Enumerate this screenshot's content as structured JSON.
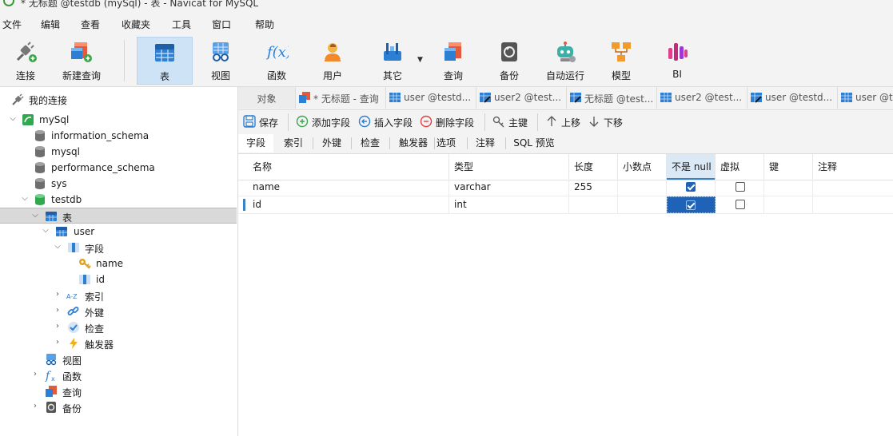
{
  "window": {
    "title": "* 无标题 @testdb (mySql) - 表 - Navicat for MySQL"
  },
  "menu": [
    "文件",
    "编辑",
    "查看",
    "收藏夹",
    "工具",
    "窗口",
    "帮助"
  ],
  "toolbar": {
    "items": [
      {
        "label": "连接",
        "icon": "connection-plug-icon"
      },
      {
        "label": "新建查询",
        "icon": "new-query-icon"
      },
      {
        "label": "表",
        "icon": "table-icon",
        "active": true
      },
      {
        "label": "视图",
        "icon": "view-icon"
      },
      {
        "label": "函数",
        "icon": "function-icon",
        "glyph": "f(x)"
      },
      {
        "label": "用户",
        "icon": "user-icon"
      },
      {
        "label": "其它",
        "icon": "tools-icon"
      },
      {
        "label": "查询",
        "icon": "query-icon"
      },
      {
        "label": "备份",
        "icon": "backup-icon"
      },
      {
        "label": "自动运行",
        "icon": "robot-icon"
      },
      {
        "label": "模型",
        "icon": "model-icon"
      },
      {
        "label": "BI",
        "icon": "bi-icon"
      }
    ]
  },
  "sidebar": {
    "header": "我的连接",
    "tree": [
      {
        "label": "mySql",
        "icon": "mysql-connection-icon",
        "chevron": "down"
      },
      {
        "label": "information_schema",
        "icon": "database-icon"
      },
      {
        "label": "mysql",
        "icon": "database-icon"
      },
      {
        "label": "performance_schema",
        "icon": "database-icon"
      },
      {
        "label": "sys",
        "icon": "database-icon"
      },
      {
        "label": "testdb",
        "icon": "database-open-icon",
        "chevron": "down"
      },
      {
        "label": "表",
        "icon": "tables-folder-icon",
        "chevron": "down",
        "selected": true
      },
      {
        "label": "user",
        "icon": "table-icon",
        "chevron": "down"
      },
      {
        "label": "字段",
        "icon": "fields-icon",
        "chevron": "down"
      },
      {
        "label": "name",
        "icon": "primary-key-icon"
      },
      {
        "label": "id",
        "icon": "column-icon"
      },
      {
        "label": "索引",
        "icon": "index-icon",
        "glyph": "A-Z",
        "chevron": "right"
      },
      {
        "label": "外键",
        "icon": "foreign-key-icon",
        "chevron": "right"
      },
      {
        "label": "检查",
        "icon": "check-icon",
        "chevron": "right"
      },
      {
        "label": "触发器",
        "icon": "trigger-icon",
        "chevron": "right"
      },
      {
        "label": "视图",
        "icon": "view-icon"
      },
      {
        "label": "函数",
        "icon": "function-icon",
        "chevron": "right"
      },
      {
        "label": "查询",
        "icon": "query-icon"
      },
      {
        "label": "备份",
        "icon": "backup-icon",
        "chevron": "right"
      }
    ]
  },
  "tabs": [
    {
      "label": "对象",
      "icon": ""
    },
    {
      "label": "* 无标题 - 查询",
      "icon": "query-tab-icon"
    },
    {
      "label": "user @testd...",
      "icon": "table-tab-icon"
    },
    {
      "label": "user2 @test...",
      "icon": "table-edit-tab-icon"
    },
    {
      "label": "无标题 @test...",
      "icon": "table-edit-tab-icon"
    },
    {
      "label": "user2 @test...",
      "icon": "table-tab-icon"
    },
    {
      "label": "user @testd...",
      "icon": "table-edit-tab-icon"
    },
    {
      "label": "user @t",
      "icon": "table-tab-icon"
    }
  ],
  "actions": [
    {
      "label": "保存",
      "icon": "save-icon"
    },
    {
      "label": "添加字段",
      "icon": "add-field-icon"
    },
    {
      "label": "插入字段",
      "icon": "insert-field-icon"
    },
    {
      "label": "删除字段",
      "icon": "delete-field-icon"
    },
    {
      "label": "主键",
      "icon": "primary-key-icon"
    },
    {
      "label": "上移",
      "icon": "arrow-up-icon"
    },
    {
      "label": "下移",
      "icon": "arrow-down-icon"
    }
  ],
  "subtabs": [
    "字段",
    "索引",
    "外键",
    "检查",
    "触发器",
    "选项",
    "注释",
    "SQL 预览"
  ],
  "grid": {
    "headers": [
      "名称",
      "类型",
      "长度",
      "小数点",
      "不是 null",
      "虚拟",
      "键",
      "注释"
    ],
    "rows": [
      {
        "name": "name",
        "type": "varchar",
        "length": "255",
        "decimals": "",
        "not_null": true,
        "virtual": false,
        "key": "",
        "comment": ""
      },
      {
        "name": "id",
        "type": "int",
        "length": "",
        "decimals": "",
        "not_null": true,
        "virtual": false,
        "key": "",
        "comment": ""
      }
    ]
  },
  "colors": {
    "accent": "#1e63b8",
    "selected_bg": "#cfe3f6",
    "toolbar_bg": "#f3f3f3"
  }
}
